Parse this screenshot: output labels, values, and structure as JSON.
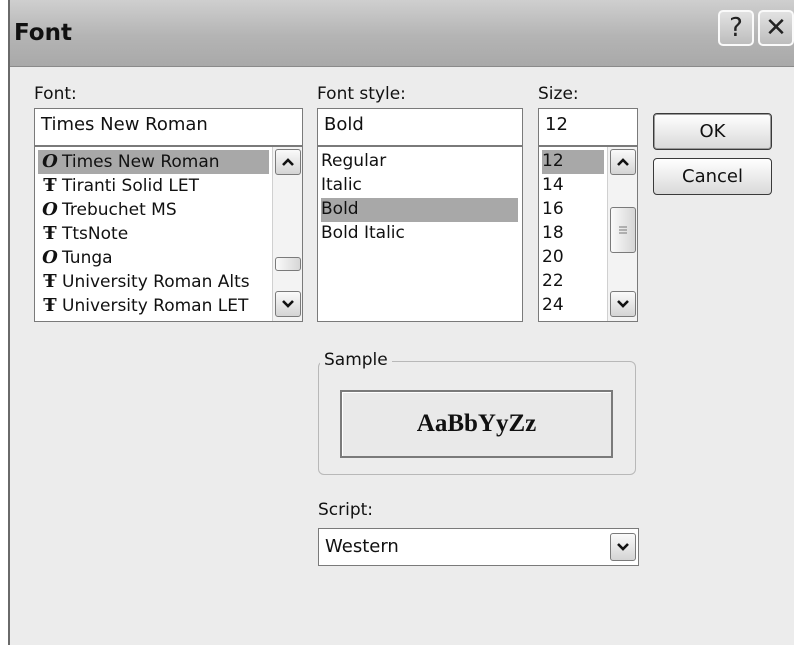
{
  "dialog": {
    "title": "Font",
    "help_icon": "?",
    "close_icon": "✕"
  },
  "font": {
    "label": "Font:",
    "value": "Times New Roman",
    "items": [
      {
        "label": "Times New Roman",
        "icon": "opentype-icon",
        "glyph": "O",
        "selected": true
      },
      {
        "label": "Tiranti Solid LET",
        "icon": "truetype-icon",
        "glyph": "Ŧ",
        "selected": false
      },
      {
        "label": "Trebuchet MS",
        "icon": "opentype-icon",
        "glyph": "O",
        "selected": false
      },
      {
        "label": "TtsNote",
        "icon": "truetype-icon",
        "glyph": "Ŧ",
        "selected": false
      },
      {
        "label": "Tunga",
        "icon": "opentype-icon",
        "glyph": "O",
        "selected": false
      },
      {
        "label": "University Roman Alts",
        "icon": "truetype-icon",
        "glyph": "Ŧ",
        "selected": false
      },
      {
        "label": "University Roman LET",
        "icon": "truetype-icon",
        "glyph": "Ŧ",
        "selected": false
      }
    ]
  },
  "style": {
    "label": "Font style:",
    "value": "Bold",
    "items": [
      {
        "label": "Regular",
        "selected": false
      },
      {
        "label": "Italic",
        "selected": false
      },
      {
        "label": "Bold",
        "selected": true
      },
      {
        "label": "Bold Italic",
        "selected": false
      }
    ]
  },
  "size": {
    "label": "Size:",
    "value": "12",
    "items": [
      {
        "label": "12",
        "selected": true
      },
      {
        "label": "14",
        "selected": false
      },
      {
        "label": "16",
        "selected": false
      },
      {
        "label": "18",
        "selected": false
      },
      {
        "label": "20",
        "selected": false
      },
      {
        "label": "22",
        "selected": false
      },
      {
        "label": "24",
        "selected": false
      }
    ]
  },
  "buttons": {
    "ok": "OK",
    "cancel": "Cancel"
  },
  "sample": {
    "label": "Sample",
    "text": "AaBbYyZz"
  },
  "script": {
    "label": "Script:",
    "value": "Western"
  },
  "colors": {
    "selection": "#a8a8a8",
    "dialog_bg": "#ececec"
  }
}
